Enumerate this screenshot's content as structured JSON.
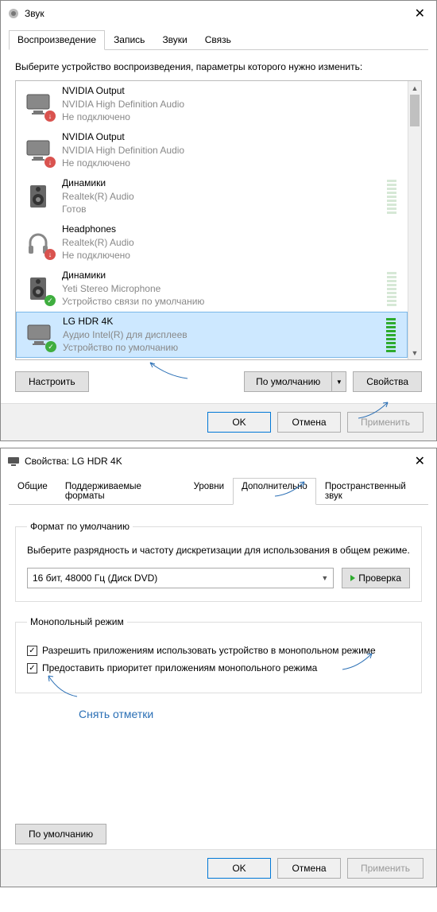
{
  "win1": {
    "title": "Звук",
    "tabs": [
      "Воспроизведение",
      "Запись",
      "Звуки",
      "Связь"
    ],
    "active_tab": 0,
    "instruction": "Выберите устройство воспроизведения, параметры которого нужно изменить:",
    "devices": [
      {
        "name": "NVIDIA Output",
        "line1": "NVIDIA High Definition Audio",
        "line2": "Не подключено",
        "icon": "monitor",
        "badge": "off",
        "meter": null
      },
      {
        "name": "NVIDIA Output",
        "line1": "NVIDIA High Definition Audio",
        "line2": "Не подключено",
        "icon": "monitor",
        "badge": "off",
        "meter": null
      },
      {
        "name": "Динамики",
        "line1": "Realtek(R) Audio",
        "line2": "Готов",
        "icon": "speaker",
        "badge": null,
        "meter": "low"
      },
      {
        "name": "Headphones",
        "line1": "Realtek(R) Audio",
        "line2": "Не подключено",
        "icon": "headphones",
        "badge": "off",
        "meter": null
      },
      {
        "name": "Динамики",
        "line1": "Yeti Stereo Microphone",
        "line2": "Устройство связи по умолчанию",
        "icon": "speaker",
        "badge": "ok",
        "meter": "low"
      },
      {
        "name": "LG HDR 4K",
        "line1": "Аудио Intel(R) для дисплеев",
        "line2": "Устройство по умолчанию",
        "icon": "monitor",
        "badge": "ok",
        "meter": "full",
        "selected": true
      }
    ],
    "buttons": {
      "configure": "Настроить",
      "default": "По умолчанию",
      "properties": "Свойства",
      "ok": "OK",
      "cancel": "Отмена",
      "apply": "Применить"
    }
  },
  "win2": {
    "title": "Свойства: LG HDR 4K",
    "tabs": [
      "Общие",
      "Поддерживаемые форматы",
      "Уровни",
      "Дополнительно",
      "Пространственный звук"
    ],
    "active_tab": 3,
    "format_group": {
      "legend": "Формат по умолчанию",
      "desc": "Выберите разрядность и частоту дискретизации для использования в общем режиме.",
      "combo_value": "16 бит, 48000 Гц (Диск DVD)",
      "test": "Проверка"
    },
    "excl_group": {
      "legend": "Монопольный режим",
      "cb1": "Разрешить приложениям использовать устройство в монопольном режиме",
      "cb2": "Предоставить приоритет приложениям монопольного режима"
    },
    "annotation": "Снять отметки",
    "buttons": {
      "defaults": "По умолчанию",
      "ok": "OK",
      "cancel": "Отмена",
      "apply": "Применить"
    }
  }
}
